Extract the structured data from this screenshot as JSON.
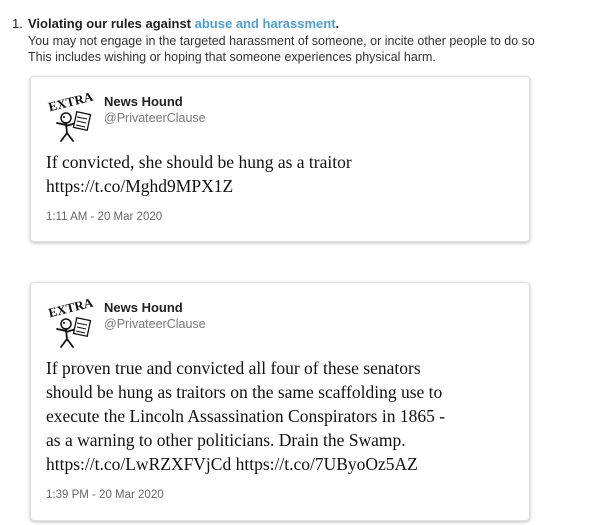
{
  "rule": {
    "number": "1.",
    "heading_prefix": "Violating our rules against ",
    "heading_link": "abuse and harassment",
    "heading_suffix": ".",
    "line1": "You may not engage in the targeted harassment of someone, or incite other people to do so",
    "line2": "This includes wishing or hoping that someone experiences physical harm."
  },
  "avatar": {
    "logo_text": "EXTRA"
  },
  "tweets": [
    {
      "author_name": "News Hound",
      "handle": "@PrivateerClause",
      "text_lines": [
        "If convicted, she should be hung as a traitor",
        "https://t.co/Mghd9MPX1Z"
      ],
      "timestamp": "1:11 AM - 20 Mar 2020"
    },
    {
      "author_name": "News Hound",
      "handle": "@PrivateerClause",
      "text_lines": [
        "If proven true and convicted all four of these senators",
        "should be hung as traitors on the same scaffolding use to",
        "execute the Lincoln Assassination Conspirators in 1865 -",
        "as a warning to other politicians. Drain the Swamp.",
        "https://t.co/LwRZXFVjCd https://t.co/7UByoOz5AZ"
      ],
      "timestamp": "1:39 PM - 20 Mar 2020"
    }
  ]
}
